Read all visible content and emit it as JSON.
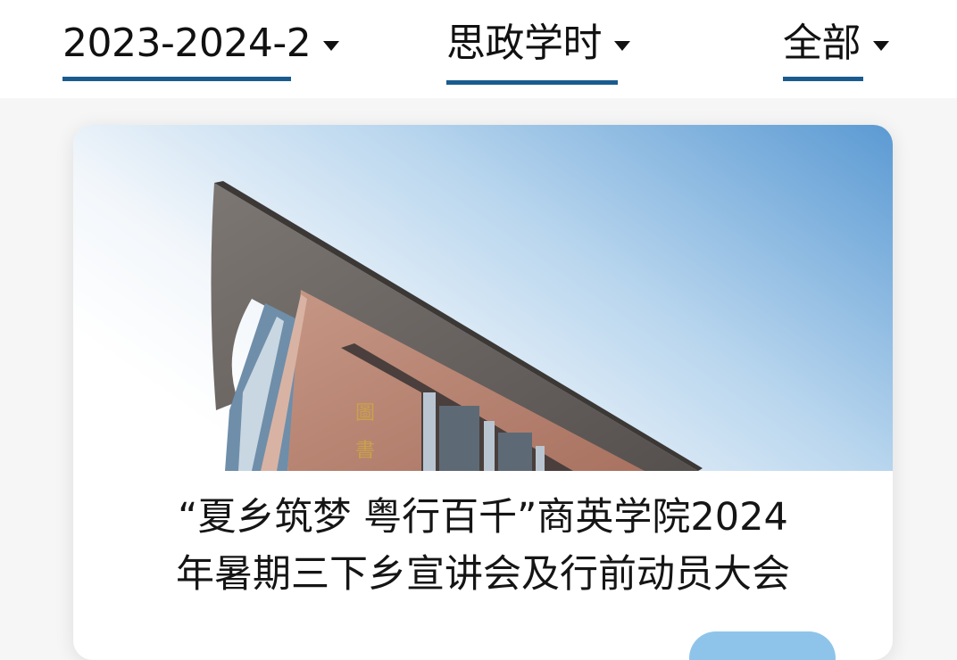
{
  "filters": {
    "semester": {
      "label": "2023-2024-2"
    },
    "type": {
      "label": "思政学时"
    },
    "scope": {
      "label": "全部"
    }
  },
  "event_card": {
    "title_line1": "“夏乡筑梦 粤行百千”商英学院2024",
    "title_line2": "年暑期三下乡宣讲会及行前动员大会",
    "image_sign_text": "圖書"
  },
  "colors": {
    "accent": "#1a5b8f",
    "action_button": "#8fc4ea",
    "sky_top": "#5b9ad3",
    "building_brick": "#b98674"
  }
}
